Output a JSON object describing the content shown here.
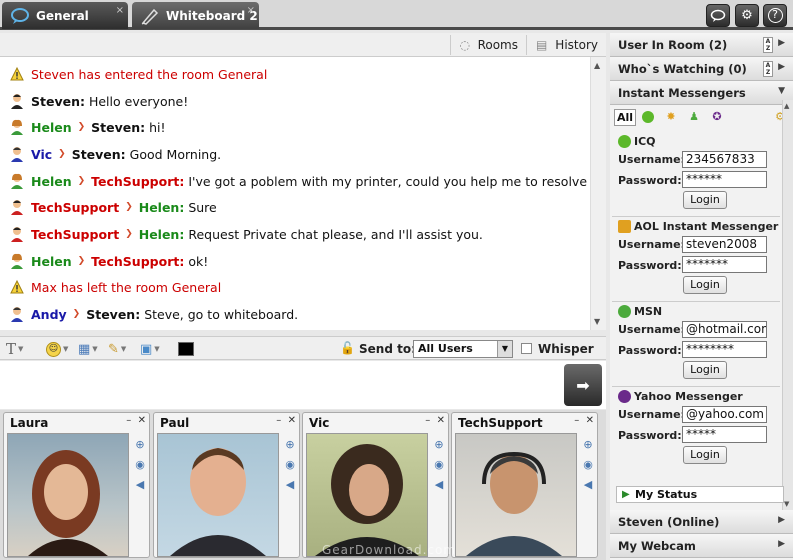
{
  "tabs": [
    {
      "label": "General",
      "close": "×"
    },
    {
      "label": "Whiteboard 2",
      "close": "×"
    }
  ],
  "chat_toolbar": {
    "rooms": "Rooms",
    "history": "History"
  },
  "messages": [
    {
      "type": "system",
      "text": "Steven has entered the room General",
      "icon": "warning-icon"
    },
    {
      "from": "Steven:",
      "text": "Hello everyone!",
      "from_color": "steven",
      "icon": "user-icon"
    },
    {
      "from": "Helen",
      "to": "Steven:",
      "text": "hi!",
      "from_color": "helen",
      "to_color": "steven",
      "icon": "user-icon"
    },
    {
      "from": "Vic",
      "to": "Steven:",
      "text": "Good Morning.",
      "from_color": "vic",
      "to_color": "steven",
      "icon": "user-icon"
    },
    {
      "from": "Helen",
      "to": "TechSupport:",
      "text": "I've got a poblem with my printer, could you help me to resolve it?",
      "from_color": "helen",
      "to_color": "tech",
      "icon": "user-icon"
    },
    {
      "from": "TechSupport",
      "to": "Helen:",
      "text": "Sure",
      "from_color": "tech",
      "to_color": "helen",
      "icon": "user-icon"
    },
    {
      "from": "TechSupport",
      "to": "Helen:",
      "text": "Request Private chat please, and I'll assist you.",
      "from_color": "tech",
      "to_color": "helen",
      "icon": "user-icon"
    },
    {
      "from": "Helen",
      "to": "TechSupport:",
      "text": "ok!",
      "from_color": "helen",
      "to_color": "tech",
      "icon": "user-icon"
    },
    {
      "type": "system",
      "text": "Max has left the room General",
      "icon": "warning-icon"
    },
    {
      "from": "Andy",
      "to": "Steven:",
      "text": "Steve, go to whiteboard.",
      "from_color": "andy",
      "to_color": "steven",
      "icon": "user-icon"
    }
  ],
  "input_bar": {
    "send_to_label": "Send to:",
    "send_to_value": "All Users",
    "whisper_label": "Whisper"
  },
  "webcams": [
    {
      "name": "Laura"
    },
    {
      "name": "Paul"
    },
    {
      "name": "Vic"
    },
    {
      "name": "TechSupport"
    }
  ],
  "right_panel": {
    "user_in_room": "User In Room (2)",
    "whos_watching": "Who`s Watching (0)",
    "instant_messengers": "Instant Messengers",
    "im_tabs": [
      "All"
    ],
    "messengers": [
      {
        "name": "ICQ",
        "username": "234567833",
        "password": "******",
        "color": "#5cb82a"
      },
      {
        "name": "AOL Instant Messenger",
        "username": "steven2008",
        "password": "*******",
        "color": "#e0a020"
      },
      {
        "name": "MSN",
        "username": "@hotmail.com",
        "password": "********",
        "color": "#4caa3c"
      },
      {
        "name": "Yahoo Messenger",
        "username": "@yahoo.com",
        "password": "*****",
        "color": "#6a2a8a"
      }
    ],
    "username_label": "Username:",
    "password_label": "Password:",
    "login_label": "Login",
    "my_status": "My Status",
    "steven_online": "Steven (Online)",
    "my_webcam": "My Webcam"
  },
  "watermark": "GearDownload.com"
}
